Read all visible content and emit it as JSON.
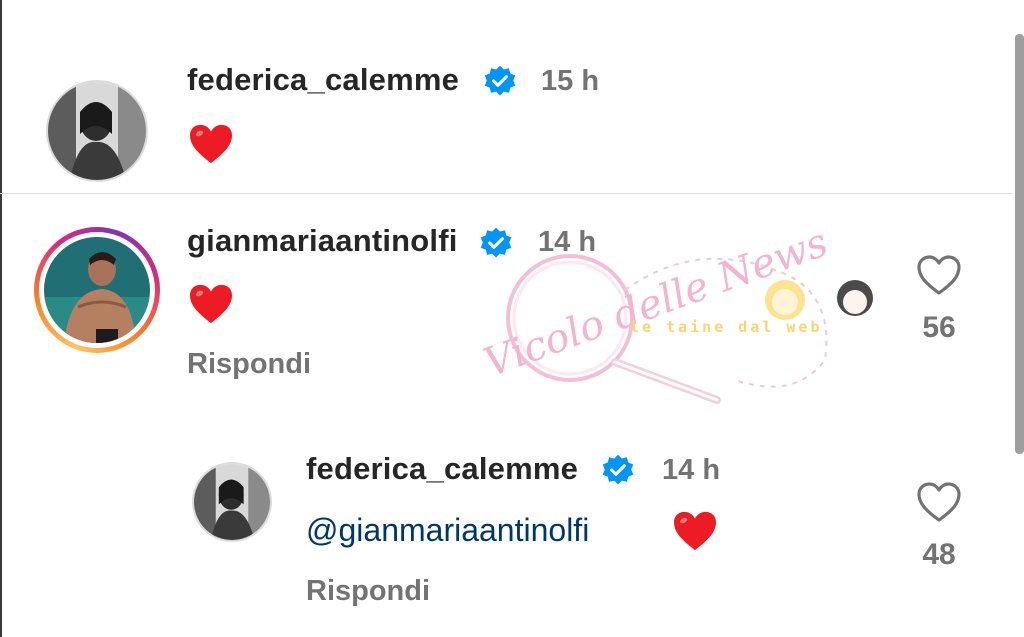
{
  "comments": [
    {
      "username": "federica_calemme",
      "time": "15 h",
      "heart": "❤",
      "has_story_ring": false
    },
    {
      "username": "gianmariaantinolfi",
      "time": "14 h",
      "heart": "❤",
      "reply_label": "Rispondi",
      "likes": "56",
      "has_story_ring": true
    },
    {
      "username": "federica_calemme",
      "time": "14 h",
      "mention": "@gianmariaantinolfi",
      "heart": "❤",
      "reply_label": "Rispondi",
      "likes": "48",
      "has_story_ring": false
    }
  ],
  "watermark": {
    "title": "Vicolo delle News",
    "subtitle": "le taine dal web"
  },
  "colors": {
    "verified": "#0095f6",
    "heart": "#ed1c24",
    "mention": "#00376b",
    "muted": "#737373"
  },
  "icons": [
    "verified-badge-icon",
    "heart-emoji-icon",
    "like-heart-icon"
  ]
}
